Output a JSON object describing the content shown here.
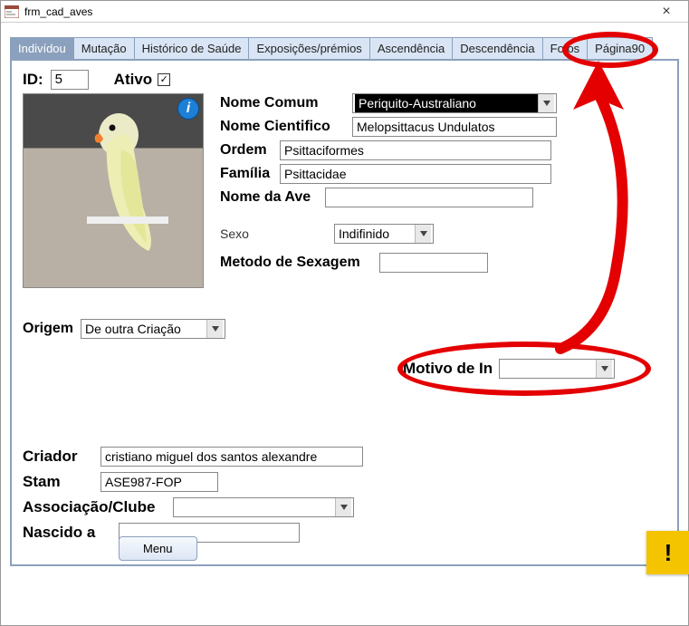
{
  "window": {
    "title": "frm_cad_aves"
  },
  "tabs": [
    {
      "label": "Indivídou",
      "active": true
    },
    {
      "label": "Mutação"
    },
    {
      "label": "Histórico de Saúde"
    },
    {
      "label": "Exposições/prémios"
    },
    {
      "label": "Ascendência"
    },
    {
      "label": "Descendência"
    },
    {
      "label": "Fotos"
    },
    {
      "label": "Página90"
    }
  ],
  "id": {
    "label": "ID:",
    "value": "5"
  },
  "ativo": {
    "label": "Ativo",
    "checked": "✓"
  },
  "fields": {
    "nome_comum_label": "Nome Comum",
    "nome_comum_value": "Periquito-Australiano",
    "nome_cientifico_label": "Nome Cientifico",
    "nome_cientifico_value": "Melopsittacus Undulatos",
    "ordem_label": "Ordem",
    "ordem_value": "Psittaciformes",
    "familia_label": "Família",
    "familia_value": "Psittacidae",
    "nome_ave_label": "Nome da Ave",
    "nome_ave_value": "",
    "sexo_label": "Sexo",
    "sexo_value": "Indifinido",
    "metodo_sexagem_label": "Metodo de Sexagem",
    "metodo_sexagem_value": ""
  },
  "origem": {
    "label": "Origem",
    "value": "De outra Criação"
  },
  "motivo": {
    "label": "Motivo de In",
    "value": ""
  },
  "bottom": {
    "criador_label": "Criador",
    "criador_value": "cristiano miguel dos santos alexandre",
    "stam_label": "Stam",
    "stam_value": "ASE987-FOP",
    "assoc_label": "Associação/Clube",
    "assoc_value": "",
    "nascido_label": "Nascido a",
    "nascido_value": ""
  },
  "menu_button": "Menu",
  "warning_glyph": "!",
  "info_glyph": "i"
}
